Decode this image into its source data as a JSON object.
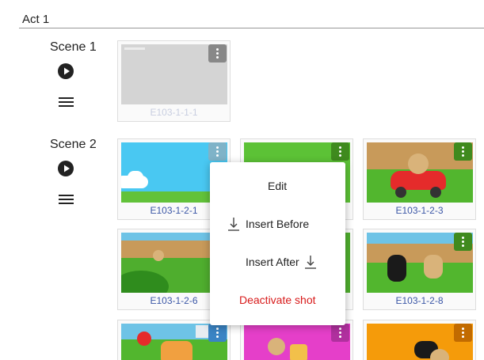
{
  "act": {
    "title": "Act 1"
  },
  "scenes": [
    {
      "title": "Scene 1",
      "play_icon": "play-circle-icon",
      "menu_icon": "hamburger-icon"
    },
    {
      "title": "Scene 2",
      "play_icon": "play-circle-icon",
      "menu_icon": "hamburger-icon"
    }
  ],
  "shots": [
    {
      "id": "E103-1-1-1",
      "active": false
    },
    {
      "id": "E103-1-2-1",
      "active": true
    },
    {
      "id": "",
      "active": true
    },
    {
      "id": "E103-1-2-3",
      "active": true
    },
    {
      "id": "E103-1-2-6",
      "active": true
    },
    {
      "id": "",
      "active": true
    },
    {
      "id": "E103-1-2-8",
      "active": true
    }
  ],
  "context_menu": {
    "edit": "Edit",
    "insert_before": "Insert Before",
    "insert_after": "Insert After",
    "deactivate": "Deactivate shot"
  },
  "colors": {
    "kebab_active": "#5a9e2a",
    "kebab_blue": "#7fb3c8",
    "kebab_grey": "#888888",
    "kebab_orange": "#d97a00",
    "kebab_magenta": "#b0309e",
    "link": "#3a56a6",
    "danger": "#d81b1b"
  }
}
